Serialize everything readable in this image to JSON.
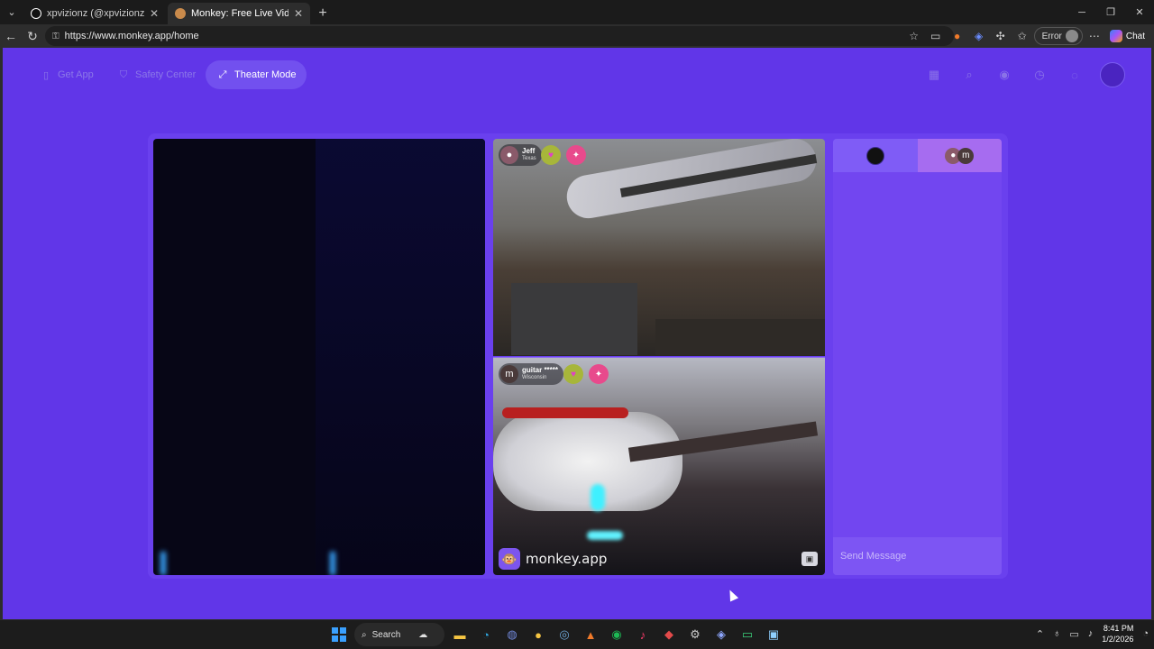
{
  "browser": {
    "tabs": [
      {
        "title": "xpvizionz (@xpvizionz) is LIVE",
        "active": false
      },
      {
        "title": "Monkey: Free Live Video Chat",
        "active": true
      }
    ],
    "url": "https://www.monkey.app/home",
    "profile_status": "Error",
    "chat_label": "Chat"
  },
  "header": {
    "get_app": "Get App",
    "safety_center": "Safety Center",
    "theater_mode": "Theater Mode"
  },
  "cams": {
    "top": {
      "name": "Jeff",
      "location": "Texas"
    },
    "bottom": {
      "name": "guitar *****",
      "location": "Wisconsin",
      "avatar_letter": "m"
    },
    "watermark": "monkey.app"
  },
  "chat": {
    "tab_right_letter": "m",
    "input_placeholder": "Send Message"
  },
  "taskbar": {
    "search_label": "Search",
    "time": "8:41 PM",
    "date": "1/2/2026"
  },
  "colors": {
    "page_bg": "#6136e8",
    "accent": "#7250ef",
    "chat_tab_active": "#a66cf0"
  }
}
